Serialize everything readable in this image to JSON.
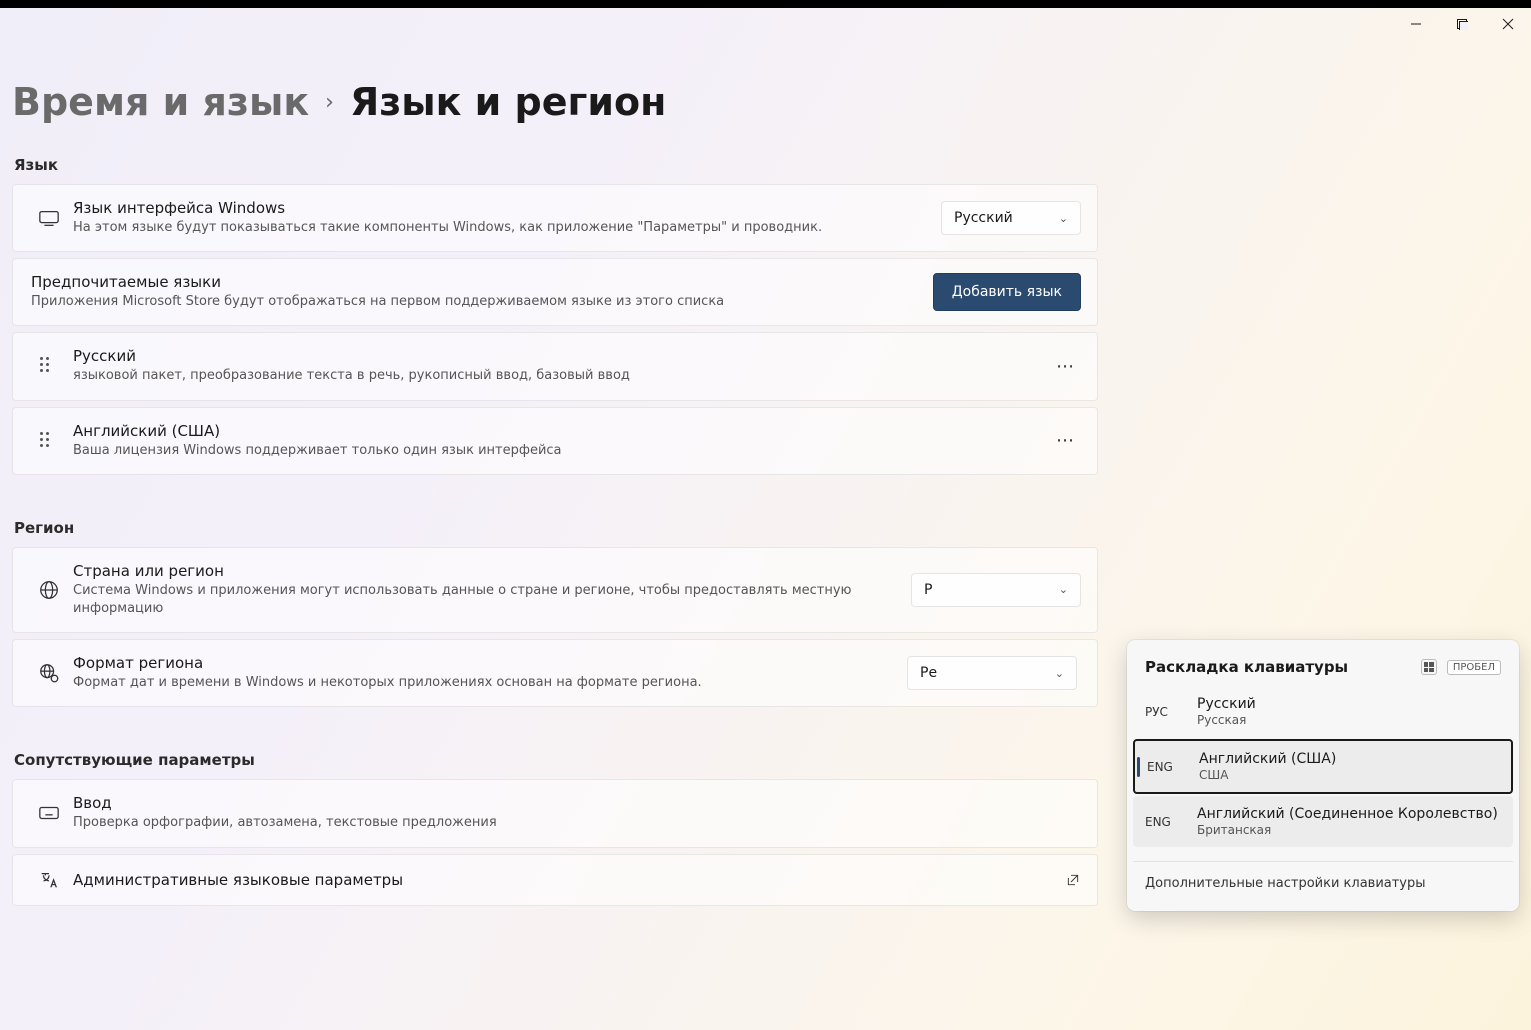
{
  "breadcrumb": {
    "parent": "Время и язык",
    "current": "Язык и регион"
  },
  "sections": {
    "language_h": "Язык",
    "region_h": "Регион",
    "related_h": "Сопутствующие параметры"
  },
  "display_lang": {
    "title": "Язык интерфейса Windows",
    "desc": "На этом языке будут показываться такие компоненты Windows, как приложение \"Параметры\" и проводник.",
    "value": "Русский"
  },
  "preferred": {
    "title": "Предпочитаемые языки",
    "desc": "Приложения Microsoft Store будут отображаться на первом поддерживаемом языке из этого списка",
    "add_btn": "Добавить язык"
  },
  "lang_items": [
    {
      "title": "Русский",
      "desc": "языковой пакет, преобразование текста в речь, рукописный ввод, базовый ввод"
    },
    {
      "title": "Английский (США)",
      "desc": "Ваша лицензия Windows поддерживает только один язык интерфейса"
    }
  ],
  "region": {
    "title": "Страна или регион",
    "desc": "Система Windows и приложения могут использовать данные о стране и регионе, чтобы предоставлять местную информацию",
    "value_prefix": "Р"
  },
  "region_fmt": {
    "title": "Формат региона",
    "desc": "Формат дат и времени в Windows и некоторых приложениях основан на формате региона.",
    "value_prefix": "Ре"
  },
  "input": {
    "title": "Ввод",
    "desc": "Проверка орфографии, автозамена, текстовые предложения"
  },
  "admin": {
    "title": "Административные языковые параметры"
  },
  "flyout": {
    "title": "Раскладка клавиатуры",
    "shortcut_key": "ПРОБЕЛ",
    "items": [
      {
        "code": "РУС",
        "title": "Русский",
        "sub": "Русская",
        "state": ""
      },
      {
        "code": "ENG",
        "title": "Английский (США)",
        "sub": "США",
        "state": "selected"
      },
      {
        "code": "ENG",
        "title": "Английский (Соединенное Королевство)",
        "sub": "Британская",
        "state": "hover"
      }
    ],
    "footer": "Дополнительные настройки клавиатуры"
  }
}
